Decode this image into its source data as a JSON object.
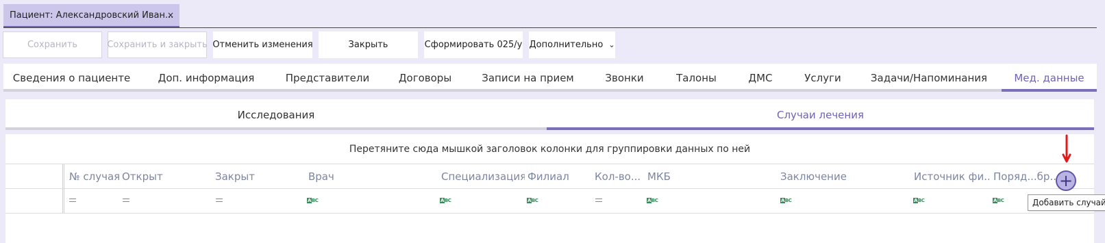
{
  "doc_tab": {
    "title": "Пациент: Александровский Иван...",
    "close": "×"
  },
  "toolbar": {
    "save": "Сохранить",
    "save_close": "Сохранить и закрыть",
    "cancel": "Отменить изменения",
    "close": "Закрыть",
    "form_025": "Сформировать 025/у",
    "more": "Дополнительно",
    "more_chevron": "⌄"
  },
  "main_tabs": [
    {
      "label": "Сведения о пациенте"
    },
    {
      "label": "Доп. информация"
    },
    {
      "label": "Представители"
    },
    {
      "label": "Договоры"
    },
    {
      "label": "Записи на прием"
    },
    {
      "label": "Звонки"
    },
    {
      "label": "Талоны"
    },
    {
      "label": "ДМС"
    },
    {
      "label": "Услуги"
    },
    {
      "label": "Задачи/Напоминания"
    },
    {
      "label": "Мед. данные"
    }
  ],
  "active_main_tab": "Мед. данные",
  "sub_tabs": [
    {
      "label": "Исследования"
    },
    {
      "label": "Случаи лечения"
    }
  ],
  "active_sub_tab": "Случаи лечения",
  "grid": {
    "group_hint": "Перетяните сюда мышкой заголовок колонки для группировки данных по ней",
    "columns": [
      {
        "label": "№ случая",
        "filter": "="
      },
      {
        "label": "Открыт",
        "filter": "="
      },
      {
        "label": "Закрыт",
        "filter": "="
      },
      {
        "label": "Врач",
        "filter": "abc"
      },
      {
        "label": "Специализация",
        "filter": "abc"
      },
      {
        "label": "Филиал",
        "filter": "abc"
      },
      {
        "label": "Кол-во...",
        "filter": "="
      },
      {
        "label": "МКБ",
        "filter": "abc"
      },
      {
        "label": "Заключение",
        "filter": "abc"
      },
      {
        "label": "Источник фи...",
        "filter": "abc"
      },
      {
        "label": "Поряд...бр...",
        "filter": "abc"
      }
    ],
    "filter_abc_text": "ABC"
  },
  "add_case": {
    "symbol": "+",
    "tooltip": "Добавить случай"
  },
  "colors": {
    "accent": "#6f63b4",
    "bg": "#eceaf8",
    "arrow": "#e0191b"
  }
}
